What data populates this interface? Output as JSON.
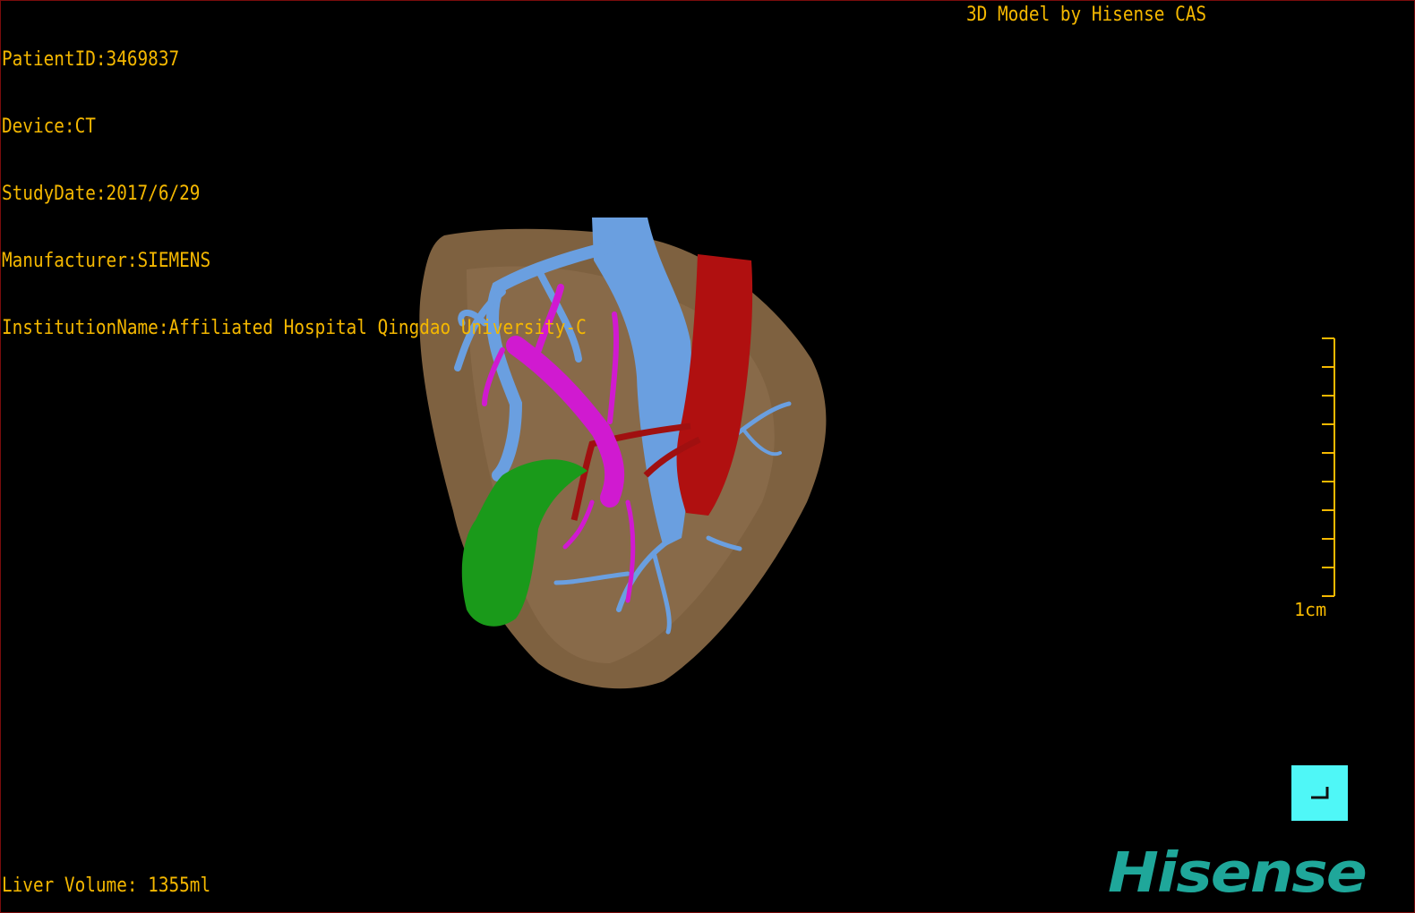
{
  "patient": {
    "patient_id": "PatientID:3469837",
    "device": "Device:CT",
    "study_date": "StudyDate:2017/6/29",
    "manufacturer": "Manufacturer:SIEMENS",
    "institution": "InstitutionName:Affiliated Hospital Qingdao University-C"
  },
  "credit": "3D Model by Hisense CAS",
  "liver_volume": "Liver Volume: 1355ml",
  "scale_bar": {
    "label": "1cm",
    "ticks": 10
  },
  "logo": "Hisense",
  "colors": {
    "overlay_text": "#f5b800",
    "liver": "#8a6a45",
    "hepatic_vein": "#6a9fe0",
    "portal_vein": "#d01ad0",
    "artery_ivc": "#b01010",
    "gallbladder": "#1a9a1a",
    "corner_button": "#4ff7f7",
    "logo": "#1fa79a",
    "frame": "#7a0c0c"
  },
  "icons": {
    "corner_button": "corner-bracket-icon"
  }
}
